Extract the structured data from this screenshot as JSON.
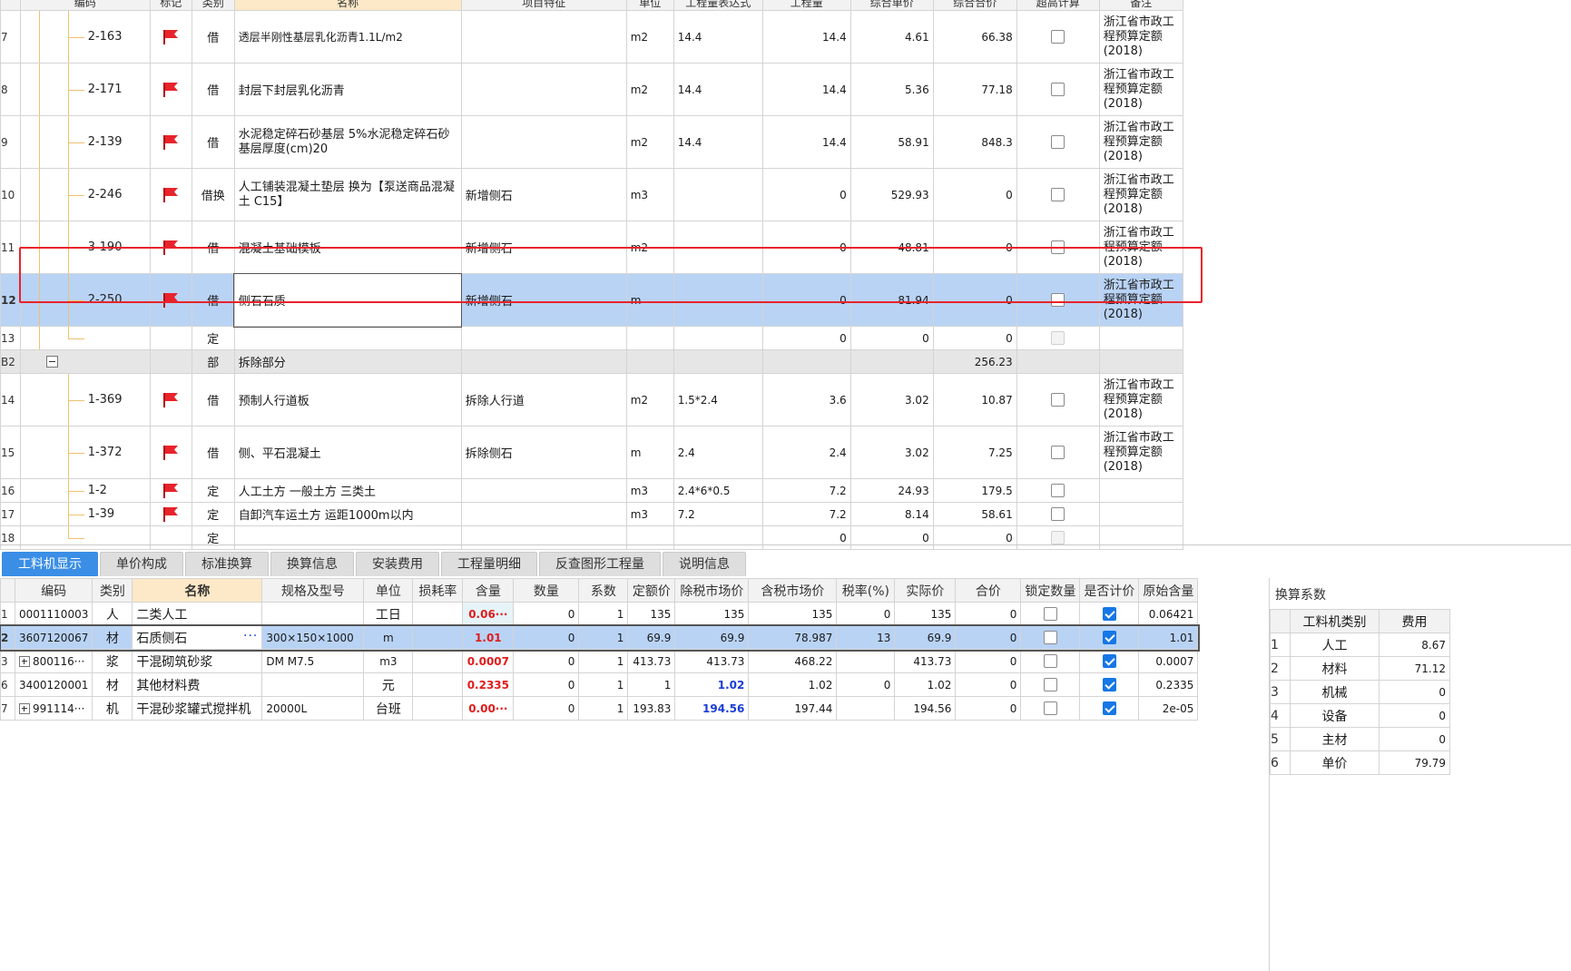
{
  "top_headers": [
    "编码",
    "标记",
    "类别",
    "名称",
    "项目特征",
    "单位",
    "工程量表达式",
    "工程量",
    "综合单价",
    "综合合价",
    "超高计算",
    "备注"
  ],
  "top_rows": [
    {
      "no": "7",
      "code": "2-163",
      "type": "借",
      "name": "透层半刚性基层乳化沥青1.1L/m2",
      "feature": "",
      "unit": "m2",
      "expr": "14.4",
      "qty": "14.4",
      "price": "4.61",
      "total": "66.38",
      "note": "浙江省市政工程预算定额(2018)"
    },
    {
      "no": "8",
      "code": "2-171",
      "type": "借",
      "name": "封层下封层乳化沥青",
      "feature": "",
      "unit": "m2",
      "expr": "14.4",
      "qty": "14.4",
      "price": "5.36",
      "total": "77.18",
      "note": "浙江省市政工程预算定额(2018)"
    },
    {
      "no": "9",
      "code": "2-139",
      "type": "借",
      "name": "水泥稳定碎石砂基层 5%水泥稳定碎石砂基层厚度(cm)20",
      "feature": "",
      "unit": "m2",
      "expr": "14.4",
      "qty": "14.4",
      "price": "58.91",
      "total": "848.3",
      "note": "浙江省市政工程预算定额(2018)"
    },
    {
      "no": "10",
      "code": "2-246",
      "type": "借换",
      "name": "人工铺装混凝土垫层  换为【泵送商品混凝土 C15】",
      "feature": "新增侧石",
      "unit": "m3",
      "expr": "",
      "qty": "0",
      "price": "529.93",
      "total": "0",
      "note": "浙江省市政工程预算定额(2018)"
    },
    {
      "no": "11",
      "code": "3-190",
      "type": "借",
      "name": "混凝土基础模板",
      "feature": "新增侧石",
      "unit": "m2",
      "expr": "",
      "qty": "0",
      "price": "48.81",
      "total": "0",
      "note": "浙江省市政工程预算定额(2018)"
    },
    {
      "no": "12",
      "code": "2-250",
      "type": "借",
      "name": "侧石石质",
      "feature": "新增侧石",
      "unit": "m",
      "expr": "",
      "qty": "0",
      "price": "81.94",
      "total": "0",
      "note": "浙江省市政工程预算定额(2018)"
    },
    {
      "no": "13",
      "code": "",
      "type": "定",
      "name": "",
      "feature": "",
      "unit": "",
      "expr": "",
      "qty": "0",
      "price": "0",
      "total": "0",
      "note": ""
    },
    {
      "no": "B2",
      "code": "",
      "type": "部",
      "name": "拆除部分",
      "feature": "",
      "unit": "",
      "expr": "",
      "qty": "",
      "price": "",
      "total": "256.23",
      "note": ""
    },
    {
      "no": "14",
      "code": "1-369",
      "type": "借",
      "name": "预制人行道板",
      "feature": "拆除人行道",
      "unit": "m2",
      "expr": "1.5*2.4",
      "qty": "3.6",
      "price": "3.02",
      "total": "10.87",
      "note": "浙江省市政工程预算定额(2018)"
    },
    {
      "no": "15",
      "code": "1-372",
      "type": "借",
      "name": "侧、平石混凝土",
      "feature": "拆除侧石",
      "unit": "m",
      "expr": "2.4",
      "qty": "2.4",
      "price": "3.02",
      "total": "7.25",
      "note": "浙江省市政工程预算定额(2018)"
    },
    {
      "no": "16",
      "code": "1-2",
      "type": "定",
      "name": "人工土方 一般土方 三类土",
      "feature": "",
      "unit": "m3",
      "expr": "2.4*6*0.5",
      "qty": "7.2",
      "price": "24.93",
      "total": "179.5",
      "note": ""
    },
    {
      "no": "17",
      "code": "1-39",
      "type": "定",
      "name": "自卸汽车运土方 运距1000m以内",
      "feature": "",
      "unit": "m3",
      "expr": "7.2",
      "qty": "7.2",
      "price": "8.14",
      "total": "58.61",
      "note": ""
    },
    {
      "no": "18",
      "code": "",
      "type": "定",
      "name": "",
      "feature": "",
      "unit": "",
      "expr": "",
      "qty": "0",
      "price": "0",
      "total": "0",
      "note": ""
    }
  ],
  "tabs": [
    "工料机显示",
    "单价构成",
    "标准换算",
    "换算信息",
    "安装费用",
    "工程量明细",
    "反查图形工程量",
    "说明信息"
  ],
  "bottom_headers": [
    "编码",
    "类别",
    "名称",
    "规格及型号",
    "单位",
    "损耗率",
    "含量",
    "数量",
    "系数",
    "定额价",
    "除税市场价",
    "含税市场价",
    "税率(%)",
    "实际价",
    "合价",
    "锁定数量",
    "是否计价",
    "原始含量"
  ],
  "bottom_rows": [
    {
      "no": "1",
      "code": "0001110003",
      "type": "人",
      "name": "二类人工",
      "spec": "",
      "unit": "工日",
      "loss": "",
      "content": "0.06···",
      "qty": "0",
      "coef": "1",
      "base": "135",
      "net": "135",
      "gross": "135",
      "tax": "0",
      "actual": "135",
      "sum": "0",
      "orig": "0.06421"
    },
    {
      "no": "2",
      "code": "3607120067",
      "type": "材",
      "name": "石质侧石",
      "spec": "300×150×1000",
      "unit": "m",
      "loss": "",
      "content": "1.01",
      "qty": "0",
      "coef": "1",
      "base": "69.9",
      "net": "69.9",
      "gross": "78.987",
      "tax": "13",
      "actual": "69.9",
      "sum": "0",
      "orig": "1.01"
    },
    {
      "no": "3",
      "code": "800116···",
      "type": "浆",
      "name": "干混砌筑砂浆",
      "spec": "DM M7.5",
      "unit": "m3",
      "loss": "",
      "content": "0.0007",
      "qty": "0",
      "coef": "1",
      "base": "413.73",
      "net": "413.73",
      "gross": "468.22",
      "tax": "",
      "actual": "413.73",
      "sum": "0",
      "orig": "0.0007"
    },
    {
      "no": "6",
      "code": "3400120001",
      "type": "材",
      "name": "其他材料费",
      "spec": "",
      "unit": "元",
      "loss": "",
      "content": "0.2335",
      "qty": "0",
      "coef": "1",
      "base": "1",
      "net": "1.02",
      "gross": "1.02",
      "tax": "0",
      "actual": "1.02",
      "sum": "0",
      "orig": "0.2335"
    },
    {
      "no": "7",
      "code": "991114···",
      "type": "机",
      "name": "干混砂浆罐式搅拌机",
      "spec": "20000L",
      "unit": "台班",
      "loss": "",
      "content": "0.00···",
      "qty": "0",
      "coef": "1",
      "base": "193.83",
      "net": "194.56",
      "gross": "197.44",
      "tax": "",
      "actual": "194.56",
      "sum": "0",
      "orig": "2e-05"
    }
  ],
  "right_panel": {
    "title": "换算系数",
    "headers": [
      "工料机类别",
      "费用"
    ],
    "rows": [
      {
        "no": "1",
        "cat": "人工",
        "val": "8.67"
      },
      {
        "no": "2",
        "cat": "材料",
        "val": "71.12"
      },
      {
        "no": "3",
        "cat": "机械",
        "val": "0"
      },
      {
        "no": "4",
        "cat": "设备",
        "val": "0"
      },
      {
        "no": "5",
        "cat": "主材",
        "val": "0"
      },
      {
        "no": "6",
        "cat": "单价",
        "val": "79.79"
      }
    ]
  },
  "colors": {
    "flag": "#e8232b",
    "selection": "#b9d3f5",
    "tab_active": "#3a8ee6",
    "highlight_red": "#e21b1b",
    "highlight_blue": "#1a3dd8"
  }
}
